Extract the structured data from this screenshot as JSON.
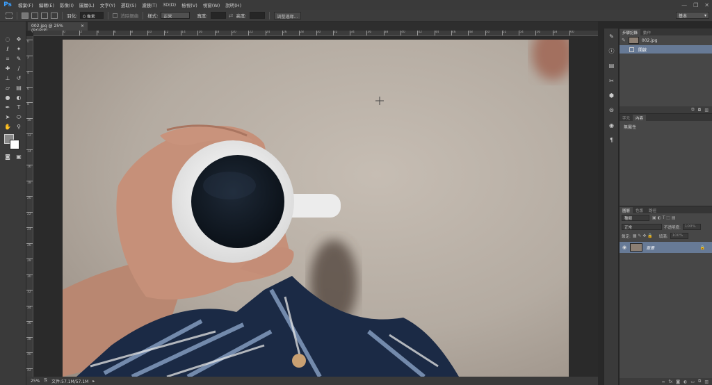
{
  "app": {
    "logo": "Ps"
  },
  "menu": [
    "檔案(F)",
    "編輯(E)",
    "影像(I)",
    "圖層(L)",
    "文字(Y)",
    "選取(S)",
    "濾鏡(T)",
    "3D(D)",
    "檢視(V)",
    "視窗(W)",
    "說明(H)"
  ],
  "options": {
    "feather_label": "羽化:",
    "feather_value": "0 像素",
    "antialias_label": "消除鋸齒",
    "style_label": "樣式:",
    "style_value": "正常",
    "width_label": "寬度:",
    "height_label": "高度:",
    "refine_button": "調整邊緣...",
    "workspace_value": "基本"
  },
  "document": {
    "tab_title": "002.jpg @ 25% (RGB/8)",
    "close": "×"
  },
  "status": {
    "zoom": "25%",
    "file_info": "文件:57.1M/57.1M"
  },
  "ruler": {
    "h_labels": [
      "0",
      "2",
      "4",
      "6",
      "8",
      "10",
      "12",
      "14",
      "16",
      "18",
      "20",
      "22",
      "24",
      "26",
      "28",
      "30",
      "32",
      "34",
      "36",
      "38",
      "40",
      "42",
      "44",
      "46",
      "48",
      "50",
      "52",
      "54",
      "56",
      "58",
      "60"
    ],
    "v_labels": [
      "0",
      "2",
      "4",
      "6",
      "8",
      "10",
      "12",
      "14",
      "16",
      "18",
      "20",
      "22",
      "24",
      "26",
      "28",
      "30",
      "32",
      "34",
      "36",
      "38",
      "40",
      "42"
    ]
  },
  "history_panel": {
    "tabs": [
      "步驟記錄",
      "動作"
    ],
    "snapshot": "002.jpg",
    "state": "開啟"
  },
  "properties_panel": {
    "tabs": [
      "字元",
      "內容"
    ],
    "empty_text": "無屬性"
  },
  "layers_panel": {
    "tabs": [
      "圖層",
      "色版",
      "路徑"
    ],
    "filter": "種類",
    "blend_mode": "正常",
    "opacity_label": "不透明度:",
    "opacity_value": "100%",
    "lock_label": "鎖定:",
    "fill_label": "填滿:",
    "fill_value": "100%",
    "layer_name": "背景"
  },
  "colors": {
    "accent": "#3ba0ff",
    "selection": "#677a96"
  }
}
